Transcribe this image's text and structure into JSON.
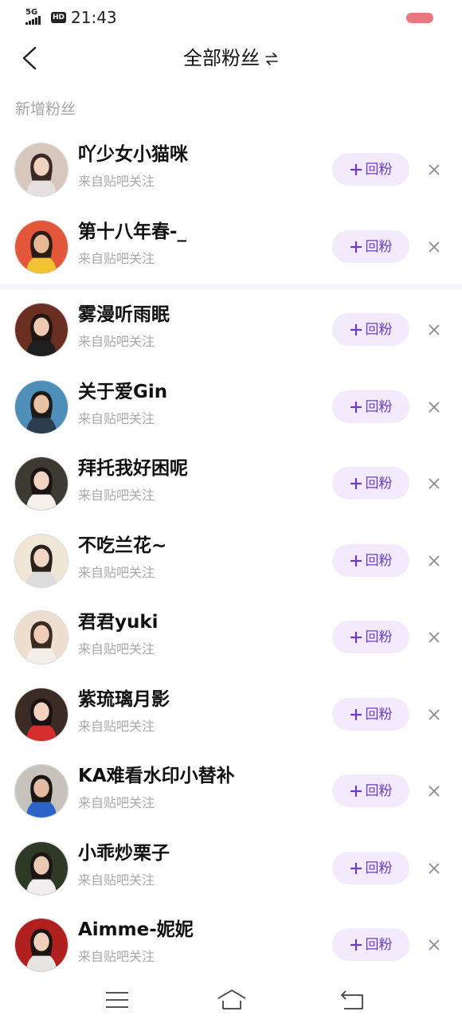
{
  "status_bar": {
    "network": "5G",
    "hd": "HD",
    "time": "21:43",
    "battery_color": "#e87880"
  },
  "header": {
    "title": "全部粉丝",
    "back_icon": "chevron-left-icon",
    "sort_icon": "swap-arrows-icon"
  },
  "section": {
    "new_fans_label": "新增粉丝"
  },
  "colors": {
    "accent": "#6a3dc9",
    "button_bg": "#f3eafd",
    "divider": "#f5f3fb",
    "muted_text": "#a9a9a9"
  },
  "fans": [
    {
      "name": "吖少女小猫咪",
      "source": "来自贴吧关注",
      "button": "回粉",
      "avatar": {
        "bg": "#d8c7bd",
        "skin": "#f0d2c0",
        "hair": "#3a2a25",
        "cloth": "#e6e0e0"
      }
    },
    {
      "name": "第十八年春-_",
      "source": "来自贴吧关注",
      "button": "回粉",
      "avatar": {
        "bg": "#e2573a",
        "skin": "#e9b896",
        "hair": "#2b1d18",
        "cloth": "#f1c232"
      }
    },
    {
      "name": "雾漫听雨眠",
      "source": "来自贴吧关注",
      "button": "回粉",
      "avatar": {
        "bg": "#6b2f22",
        "skin": "#ecc9b0",
        "hair": "#1f1614",
        "cloth": "#1f1f1f"
      }
    },
    {
      "name": "关于爱Gin",
      "source": "来自贴吧关注",
      "button": "回粉",
      "avatar": {
        "bg": "#4d8fb8",
        "skin": "#e8c2a5",
        "hair": "#1d1a1a",
        "cloth": "#2c3d4e"
      }
    },
    {
      "name": "拜托我好困呢",
      "source": "来自贴吧关注",
      "button": "回粉",
      "avatar": {
        "bg": "#3c3a33",
        "skin": "#f2d4c3",
        "hair": "#1a1414",
        "cloth": "#f5f0ea"
      }
    },
    {
      "name": "不吃兰花~",
      "source": "来自贴吧关注",
      "button": "回粉",
      "avatar": {
        "bg": "#efe6d6",
        "skin": "#f2d6c4",
        "hair": "#2a211d",
        "cloth": "#dcdcdc"
      }
    },
    {
      "name": "君君yuki",
      "source": "来自贴吧关注",
      "button": "回粉",
      "avatar": {
        "bg": "#eeded0",
        "skin": "#efcdb8",
        "hair": "#3b2a22",
        "cloth": "#f3efe8"
      }
    },
    {
      "name": "紫琉璃月影",
      "source": "来自贴吧关注",
      "button": "回粉",
      "avatar": {
        "bg": "#3a2c24",
        "skin": "#f1d0bd",
        "hair": "#181212",
        "cloth": "#d62d2d"
      }
    },
    {
      "name": "KA难看水印小替补",
      "source": "来自贴吧关注",
      "button": "回粉",
      "avatar": {
        "bg": "#c7c2bb",
        "skin": "#e4bca2",
        "hair": "#1c1717",
        "cloth": "#2b63c9"
      }
    },
    {
      "name": "小乖炒栗子",
      "source": "来自贴吧关注",
      "button": "回粉",
      "avatar": {
        "bg": "#2e3a25",
        "skin": "#ebc8b1",
        "hair": "#1b1614",
        "cloth": "#f0eeee"
      }
    },
    {
      "name": "Aimme-妮妮",
      "source": "来自贴吧关注",
      "button": "回粉",
      "avatar": {
        "bg": "#b0201e",
        "skin": "#f0d0bd",
        "hair": "#1e1513",
        "cloth": "#e8e4e2"
      }
    }
  ],
  "navbar": {
    "menu_icon": "menu-icon",
    "home_icon": "home-icon",
    "back_icon": "return-icon"
  }
}
